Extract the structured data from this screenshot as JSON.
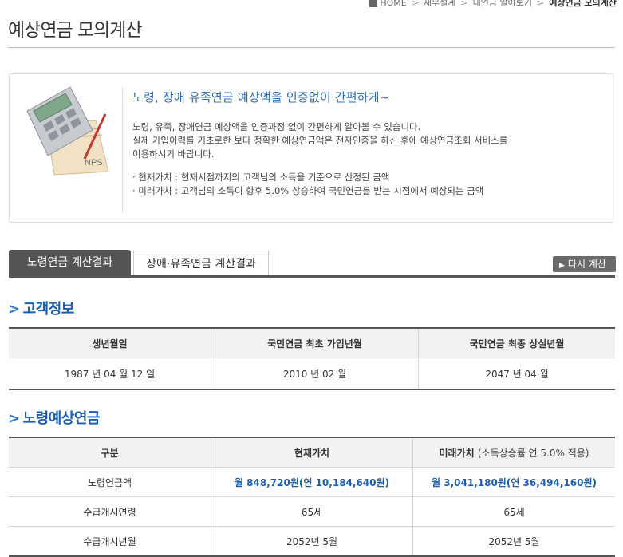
{
  "breadcrumb": {
    "home": "HOME",
    "items": [
      "재무설계",
      "내연금 알아보기",
      "예상연금 모의계산"
    ]
  },
  "page_title": "예상연금 모의계산",
  "intro": {
    "illustration_label": "NPS",
    "headline": "노령, 장애 유족연금 예상액을 인증없이 간편하게~",
    "para1": "노령, 유족, 장애연금 예상액을 인증과정 없이 간편하게 알아볼 수 있습니다.",
    "para2": "실제 가입이력를 기초로한 보다 정확한 예상연금액은 전자인증을 하신 후에 예상연금조회 서비스를",
    "para3": "이용하시기 바랍니다.",
    "bullet1": "· 현재가치 : 현재시점까지의 고객님의 소득을 기준으로 산정된 금액",
    "bullet2": "· 미래가치 : 고객님의 소득이 향후 5.0% 상승하여 국민연금를 받는 시점에서 예상되는 금액"
  },
  "tabs": [
    {
      "label": "노령연금 계산결과",
      "active": true
    },
    {
      "label": "장애·유족연금 계산결과",
      "active": false
    }
  ],
  "recalc_button": "다시 계산",
  "customer": {
    "title": "고객정보",
    "headers": [
      "생년월일",
      "국민연금 최초 가입년월",
      "국민연금 최종 상실년월"
    ],
    "values": [
      "1987 년 04 월 12 일",
      "2010 년 02 월",
      "2047 년 04 월"
    ]
  },
  "pension": {
    "title": "노령예상연금",
    "headers": {
      "c1": "구분",
      "c2": "현재가치",
      "c3": "미래가치",
      "c3_note": "(소득상승률 연 5.0% 적용)"
    },
    "rows": [
      {
        "label": "노령연금액",
        "current": "월 848,720원(연 10,184,640원)",
        "future": "월 3,041,180원(연 36,494,160원)"
      },
      {
        "label": "수급개시연령",
        "current": "65세",
        "future": "65세"
      },
      {
        "label": "수급개시년월",
        "current": "2052년 5월",
        "future": "2052년 5월"
      }
    ]
  },
  "colors": {
    "accent": "#1e5eae",
    "tab_active": "#545454",
    "header_bg": "#f2f2f2"
  }
}
